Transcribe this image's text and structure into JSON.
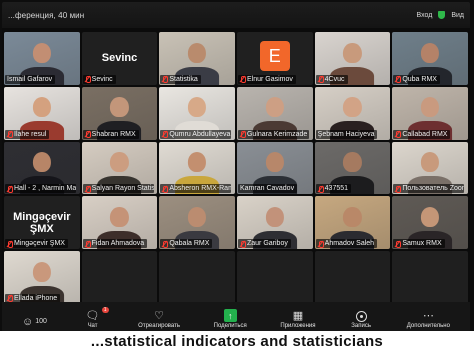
{
  "window": {
    "title": "...ференция, 40 мин",
    "login_label": "Вход",
    "right_label": "Вид"
  },
  "tiles": [
    {
      "name": "İsmail Gafarov",
      "muted": false,
      "kind": "video",
      "bg": "#7b8a98",
      "face": "#c28e73",
      "body": "#2b2b33"
    },
    {
      "name": "Sevinc",
      "muted": true,
      "kind": "name",
      "display": "Sevinc"
    },
    {
      "name": "Statistika",
      "muted": true,
      "kind": "video",
      "bg": "#c9c2b6",
      "face": "#b98b6d",
      "body": "#3a3c45"
    },
    {
      "name": "Elnur Gasimov",
      "muted": true,
      "kind": "avatar",
      "avatar": "E"
    },
    {
      "name": "4Cvuc",
      "muted": true,
      "kind": "video",
      "bg": "#d9d4cf",
      "face": "#c89a7c",
      "body": "#6b4a3c"
    },
    {
      "name": "Quba RMX",
      "muted": true,
      "kind": "video",
      "bg": "#6f7f8a",
      "face": "#b48268",
      "body": "#23262c"
    },
    {
      "name": "İlahe resul",
      "muted": true,
      "kind": "video",
      "bg": "#e7e3df",
      "face": "#d4a17f",
      "body": "#9a3b2f"
    },
    {
      "name": "Shabran RMX",
      "muted": true,
      "kind": "video",
      "bg": "#7a6f63",
      "face": "#c3967a",
      "body": "#1f1f23"
    },
    {
      "name": "Qumru Abdullayeva",
      "muted": true,
      "kind": "video",
      "bg": "#e9e6e1",
      "face": "#d7a988",
      "body": "#e0dcd6"
    },
    {
      "name": "Gulnara Kerimzade",
      "muted": true,
      "kind": "video",
      "bg": "#b9b4ae",
      "face": "#cd9f84",
      "body": "#4b3a34"
    },
    {
      "name": "Şebnam Haciyeva",
      "muted": false,
      "kind": "video",
      "bg": "#d6cfc6",
      "face": "#d2a386",
      "body": "#2a2020"
    },
    {
      "name": "Callabad RMX",
      "muted": true,
      "kind": "video",
      "bg": "#bfb5aa",
      "face": "#c99a7f",
      "body": "#6d2f30"
    },
    {
      "name": "Hall - 2 , Narmin Mammado...",
      "muted": true,
      "kind": "video",
      "bg": "#2e2e33",
      "face": "#b78567",
      "body": "#15151a"
    },
    {
      "name": "Salyan Rayon Statistik... Dol...",
      "muted": true,
      "kind": "video",
      "bg": "#d5ccc1",
      "face": "#cc9d80",
      "body": "#37342f"
    },
    {
      "name": "Absheron RMX-Ramin",
      "muted": true,
      "kind": "video",
      "bg": "#e0dbd3",
      "face": "#c38f6f",
      "body": "#c9a73c"
    },
    {
      "name": "Kamran Cavadov",
      "muted": false,
      "kind": "video",
      "bg": "#8a8f95",
      "face": "#b7876a",
      "body": "#2b2f35"
    },
    {
      "name": "437551",
      "muted": true,
      "kind": "video",
      "bg": "#6c6a68",
      "face": "#a57a60",
      "body": "#1c1c1e"
    },
    {
      "name": "Пользователь Zoom",
      "muted": true,
      "kind": "video",
      "bg": "#dcd6cd",
      "face": "#c89a7c",
      "body": "#7a7068"
    },
    {
      "name": "Mingəçevir ŞMX",
      "muted": true,
      "kind": "name",
      "display": "Mingəçevir ŞMX"
    },
    {
      "name": "Fidan Ahmadova",
      "muted": true,
      "kind": "video",
      "bg": "#d8cfc5",
      "face": "#c59377",
      "body": "#3d2e2a"
    },
    {
      "name": "Qabala RMX",
      "muted": true,
      "kind": "video",
      "bg": "#9c8f80",
      "face": "#bb8c70",
      "body": "#3a3a40"
    },
    {
      "name": "Zaur Gariboy",
      "muted": true,
      "kind": "video",
      "bg": "#d9d2c8",
      "face": "#c2927a",
      "body": "#2e2e33"
    },
    {
      "name": "Ahmadov Saleh",
      "muted": true,
      "kind": "video",
      "bg": "#c6a880",
      "face": "#b98868",
      "body": "#2b2b30"
    },
    {
      "name": "Samux RMX",
      "muted": true,
      "kind": "video",
      "bg": "#5f5a55",
      "face": "#c49677",
      "body": "#2a2527"
    },
    {
      "name": "Ellada iPhone",
      "muted": true,
      "kind": "video",
      "bg": "#dfd9d0",
      "face": "#c9987c",
      "body": "#3b332f"
    },
    {
      "name": "",
      "muted": false,
      "kind": "blank"
    },
    {
      "name": "",
      "muted": false,
      "kind": "blank"
    },
    {
      "name": "",
      "muted": false,
      "kind": "blank"
    },
    {
      "name": "",
      "muted": false,
      "kind": "blank"
    },
    {
      "name": "",
      "muted": false,
      "kind": "blank"
    }
  ],
  "toolbar": {
    "participants_count": "100",
    "chat_label": "Чат",
    "react_label": "Отреагировать",
    "share_label": "Поделиться",
    "apps_label": "Приложения",
    "record_label": "Запись",
    "more_label": "Дополнительно",
    "chat_badge": "1"
  },
  "caption": "...statistical indicators and statisticians"
}
